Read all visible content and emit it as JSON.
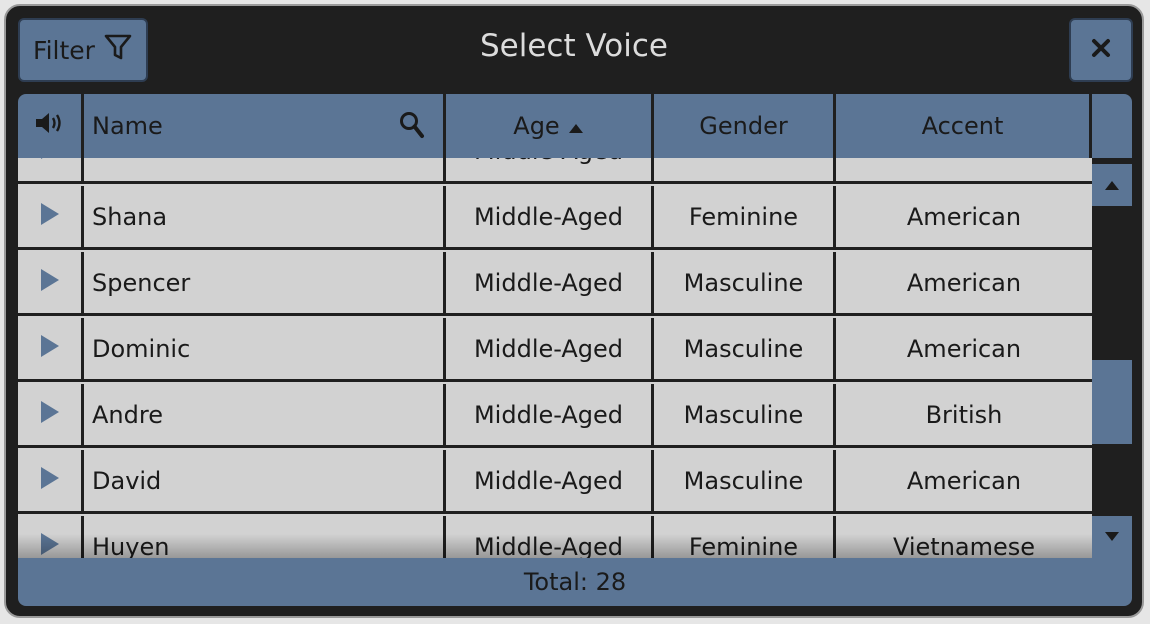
{
  "dialog": {
    "title": "Select Voice",
    "filter_label": "Filter",
    "footer_total": "Total: 28"
  },
  "columns": {
    "name": "Name",
    "age": "Age",
    "gender": "Gender",
    "accent": "Accent"
  },
  "rows": [
    {
      "name": "",
      "age": "Middle-Aged",
      "gender": "",
      "accent": ""
    },
    {
      "name": "Shana",
      "age": "Middle-Aged",
      "gender": "Feminine",
      "accent": "American"
    },
    {
      "name": "Spencer",
      "age": "Middle-Aged",
      "gender": "Masculine",
      "accent": "American"
    },
    {
      "name": "Dominic",
      "age": "Middle-Aged",
      "gender": "Masculine",
      "accent": "American"
    },
    {
      "name": "Andre",
      "age": "Middle-Aged",
      "gender": "Masculine",
      "accent": "British"
    },
    {
      "name": "David",
      "age": "Middle-Aged",
      "gender": "Masculine",
      "accent": "American"
    },
    {
      "name": "Huyen",
      "age": "Middle-Aged",
      "gender": "Feminine",
      "accent": "Vietnamese"
    }
  ],
  "icons": {
    "filter": "filter-icon",
    "close": "close-icon",
    "speaker": "speaker-icon",
    "search": "search-icon",
    "sort": "sort-ascending-icon",
    "play": "play-icon",
    "scroll_up": "scroll-up-icon",
    "scroll_down": "scroll-down-icon"
  },
  "colors": {
    "accent": "#5b7595",
    "background": "#1f1f1f",
    "row": "#d2d2d2",
    "title": "#dcdcdc"
  }
}
